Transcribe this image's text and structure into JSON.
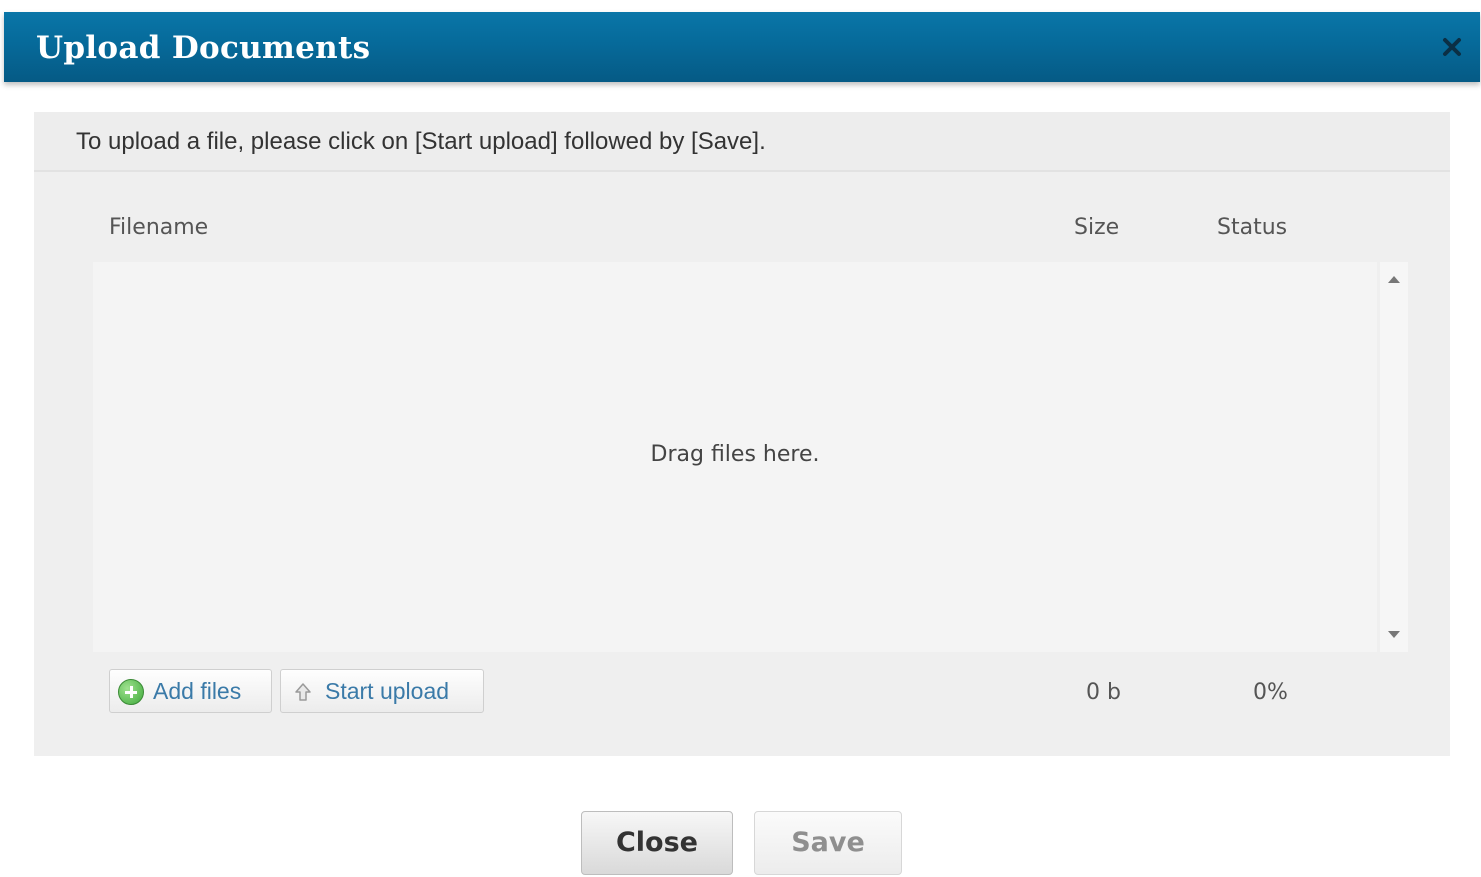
{
  "dialog": {
    "title": "Upload Documents",
    "instructions": "To upload a file, please click on [Start upload] followed by [Save]."
  },
  "table": {
    "columns": {
      "filename": "Filename",
      "size": "Size",
      "status": "Status"
    },
    "empty_message": "Drag files here.",
    "total_size": "0 b",
    "total_status": "0%"
  },
  "toolbar": {
    "add_files_label": "Add files",
    "start_upload_label": "Start upload"
  },
  "footer": {
    "close_label": "Close",
    "save_label": "Save"
  },
  "colors": {
    "titlebar": "#066a9a",
    "link": "#3a7aa8",
    "panel": "#efefef"
  }
}
